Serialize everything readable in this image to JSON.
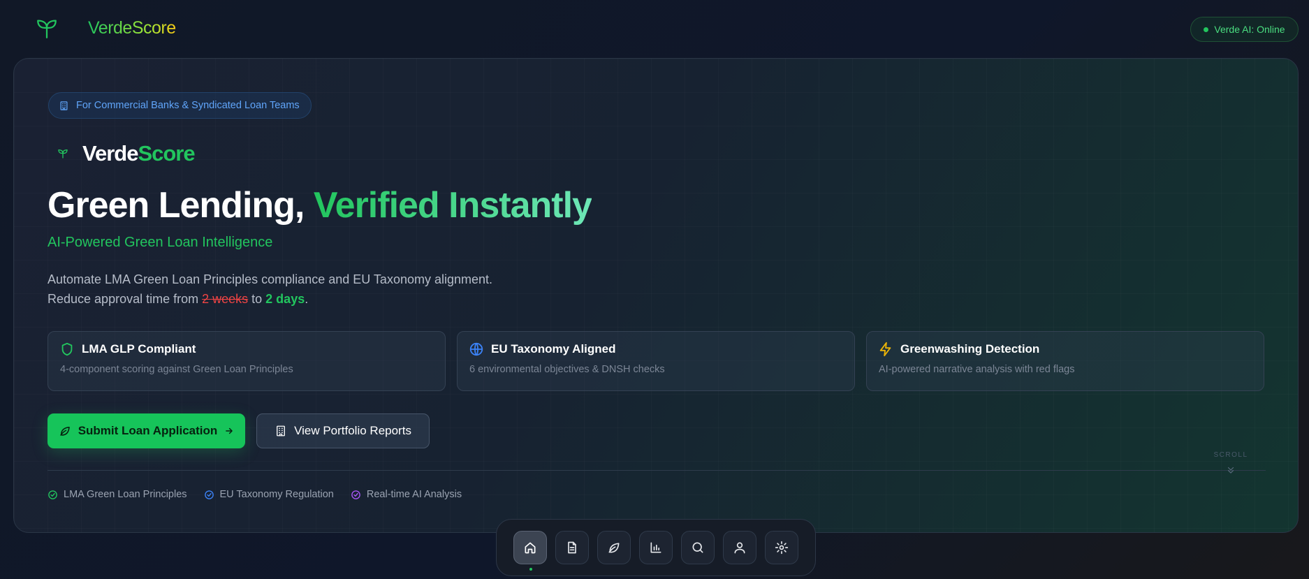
{
  "app": {
    "name": "VerdeScore",
    "status_text": "Verde AI: Online"
  },
  "hero": {
    "audience": "For Commercial Banks & Syndicated Loan Teams",
    "logo_part1": "Verde",
    "logo_part2": "Score",
    "headline_part1": "Green Lending, ",
    "headline_part2": "Verified Instantly",
    "subheadline": "AI-Powered Green Loan Intelligence",
    "description_line1": "Automate LMA Green Loan Principles compliance and EU Taxonomy alignment.",
    "description_prefix": "Reduce approval time from ",
    "description_old": "2 weeks",
    "description_mid": " to ",
    "description_new": "2 days",
    "description_suffix": "."
  },
  "features": [
    {
      "title": "LMA GLP Compliant",
      "description": "4-component scoring against Green Loan Principles",
      "icon": "shield-icon",
      "color": "#22c55e"
    },
    {
      "title": "EU Taxonomy Aligned",
      "description": "6 environmental objectives & DNSH checks",
      "icon": "globe-icon",
      "color": "#3b82f6"
    },
    {
      "title": "Greenwashing Detection",
      "description": "AI-powered narrative analysis with red flags",
      "icon": "lightning-icon",
      "color": "#eab308"
    }
  ],
  "actions": {
    "primary_label": "Submit Loan Application",
    "secondary_label": "View Portfolio Reports"
  },
  "badges": [
    {
      "label": "LMA Green Loan Principles",
      "color": "#22c55e"
    },
    {
      "label": "EU Taxonomy Regulation",
      "color": "#3b82f6"
    },
    {
      "label": "Real-time AI Analysis",
      "color": "#a855f7"
    }
  ],
  "scroll_hint": "SCROLL",
  "dock": {
    "items": [
      "home-icon",
      "document-icon",
      "leaf-icon",
      "bar-chart-icon",
      "search-icon",
      "user-icon",
      "settings-icon"
    ],
    "active": "home-icon"
  },
  "colors": {
    "accent": "#22c55e",
    "info": "#3b82f6",
    "warning": "#eab308",
    "danger": "#ef4444",
    "ai": "#a855f7"
  }
}
